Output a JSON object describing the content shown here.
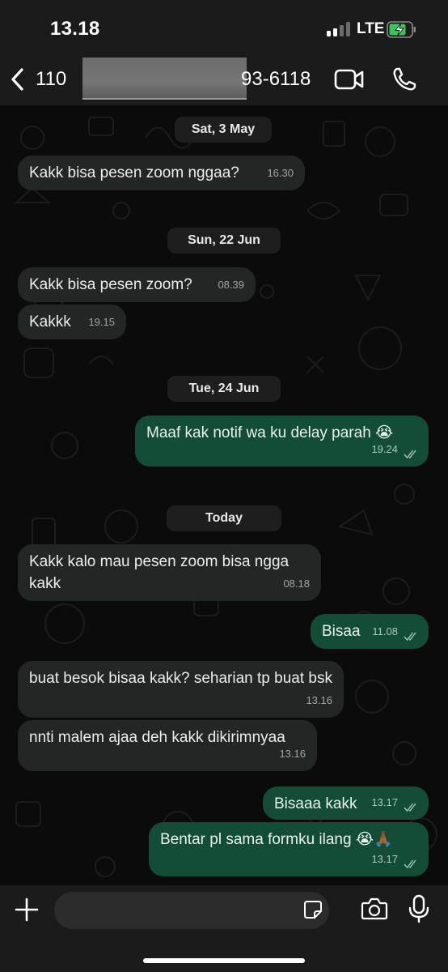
{
  "status_bar": {
    "time": "13.18",
    "network": "LTE",
    "icons": [
      "signal-icon",
      "battery-charging-icon"
    ]
  },
  "header": {
    "back_count": "110",
    "contact_visible": "93-6118",
    "icons": [
      "chevron-left-icon",
      "video-call-icon",
      "phone-icon"
    ]
  },
  "chat": {
    "date_separators": [
      "Sat, 3 May",
      "Sun, 22 Jun",
      "Tue, 24 Jun",
      "Today"
    ],
    "messages": [
      {
        "direction": "in",
        "text": "Kakk bisa pesen zoom nggaa?",
        "time": "16.30"
      },
      {
        "direction": "in",
        "text": "Kakk bisa pesen zoom?",
        "time": "08.39"
      },
      {
        "direction": "in",
        "text": "Kakkk",
        "time": "19.15"
      },
      {
        "direction": "out",
        "text": "Maaf kak notif wa ku delay parah 😭",
        "time": "19.24",
        "read": true
      },
      {
        "direction": "in",
        "text": "Kakk kalo mau pesen zoom bisa ngga kakk",
        "time": "08.18"
      },
      {
        "direction": "out",
        "text": "Bisaa",
        "time": "11.08",
        "read": true
      },
      {
        "direction": "in",
        "text": "buat besok bisaa kakk? seharian tp buat bsk",
        "time": "13.16"
      },
      {
        "direction": "in",
        "text": "nnti malem ajaa deh kakk dikirimnyaa",
        "time": "13.16"
      },
      {
        "direction": "out",
        "text": "Bisaaa kakk",
        "time": "13.17",
        "read": true
      },
      {
        "direction": "out",
        "text": "Bentar pl sama formku ilang 😭🙏🏾",
        "time": "13.17",
        "read": true
      }
    ]
  },
  "input_bar": {
    "message_value": "",
    "icons": [
      "plus-icon",
      "sticker-icon",
      "camera-icon",
      "microphone-icon"
    ]
  },
  "colors": {
    "incoming_bubble": "#242626",
    "outgoing_bubble": "#134d37",
    "background": "#0b0b0b",
    "bar": "#1b1b1b"
  }
}
